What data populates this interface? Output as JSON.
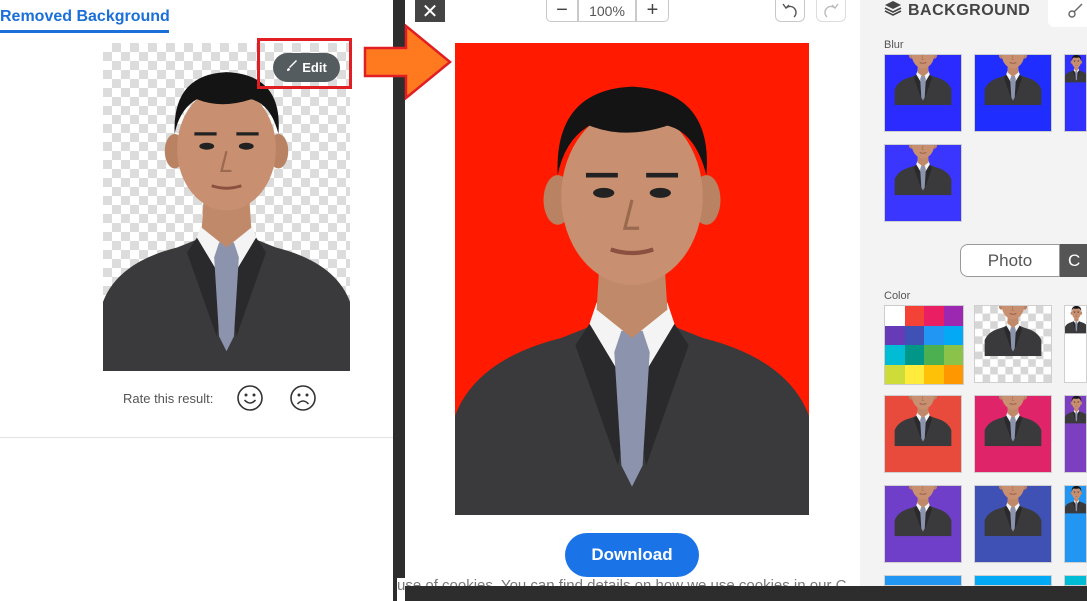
{
  "left": {
    "tab_label": "Removed Background",
    "edit_label": "Edit",
    "rate_label": "Rate this result:",
    "rate_icons": [
      "smile-icon",
      "frown-icon"
    ]
  },
  "editor": {
    "close_label": "✕",
    "zoom_out_label": "−",
    "zoom_value": "100%",
    "zoom_in_label": "+",
    "download_label": "Download",
    "background_color": "#ff1a00"
  },
  "sidebar": {
    "tab_label": "BACKGROUND",
    "blur_label": "Blur",
    "toggle_photo": "Photo",
    "toggle_color": "C",
    "color_label": "Color",
    "blur_thumbs": [
      "#2b2bff",
      "#1f2dff",
      "#3030ff",
      "#3a35ff"
    ],
    "color_thumbs": [
      "checker",
      "#ffffff",
      "#e84a3c",
      "#e0246a",
      "#7b3fbf",
      "#6f3fc9",
      "#3f51b5",
      "#2196f3"
    ],
    "palette": [
      "#ffffff",
      "#f44336",
      "#e91e63",
      "#9c27b0",
      "#673ab7",
      "#3f51b5",
      "#2196f3",
      "#03a9f4",
      "#00bcd4",
      "#009688",
      "#4caf50",
      "#8bc34a",
      "#cddc39",
      "#ffeb3b",
      "#ffc107",
      "#ff9800"
    ]
  },
  "cookie": {
    "text": "use of cookies. You can find details on how we use cookies in our C"
  },
  "colors": {
    "accent": "#1b73e8",
    "highlight_box": "#e01e23",
    "arrow": "#ff7a1f"
  }
}
